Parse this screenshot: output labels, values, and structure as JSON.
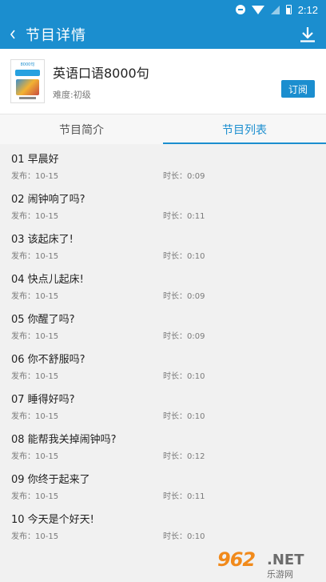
{
  "status": {
    "time": "2:12"
  },
  "appbar": {
    "title": "节目详情"
  },
  "program": {
    "cover_text": "8000句",
    "title": "英语口语8000句",
    "level": "难度:初级",
    "subscribe_label": "订阅"
  },
  "tabs": [
    {
      "label": "节目简介",
      "active": false
    },
    {
      "label": "节目列表",
      "active": true
    }
  ],
  "episodes": [
    {
      "name": "01 早晨好",
      "published": "发布：10-15",
      "duration": "时长：0:09"
    },
    {
      "name": "02 闹钟响了吗?",
      "published": "发布：10-15",
      "duration": "时长：0:11"
    },
    {
      "name": "03 该起床了!",
      "published": "发布：10-15",
      "duration": "时长：0:10"
    },
    {
      "name": "04 快点儿起床!",
      "published": "发布：10-15",
      "duration": "时长：0:09"
    },
    {
      "name": "05 你醒了吗?",
      "published": "发布：10-15",
      "duration": "时长：0:09"
    },
    {
      "name": "06 你不舒服吗?",
      "published": "发布：10-15",
      "duration": "时长：0:10"
    },
    {
      "name": "07 睡得好吗?",
      "published": "发布：10-15",
      "duration": "时长：0:10"
    },
    {
      "name": "08 能帮我关掉闹钟吗?",
      "published": "发布：10-15",
      "duration": "时长：0:12"
    },
    {
      "name": "09 你终于起来了",
      "published": "发布：10-15",
      "duration": "时长：0:11"
    },
    {
      "name": "10 今天是个好天!",
      "published": "发布：10-15",
      "duration": "时长：0:10"
    }
  ],
  "watermark": {
    "number": "962",
    "domain": ".NET",
    "sub": "乐游网"
  },
  "colors": {
    "accent": "#1b8ecf",
    "watermark_orange": "#f18a1b"
  }
}
